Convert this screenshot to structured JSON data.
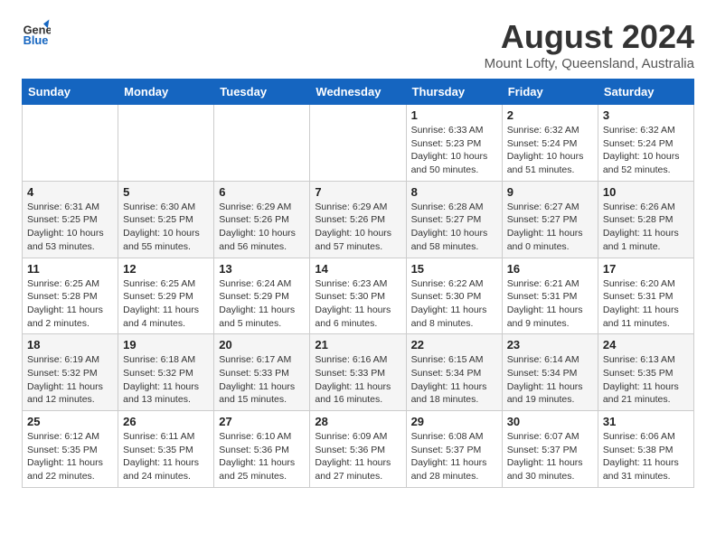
{
  "logo": {
    "line1": "General",
    "line2": "Blue"
  },
  "title": "August 2024",
  "location": "Mount Lofty, Queensland, Australia",
  "days_of_week": [
    "Sunday",
    "Monday",
    "Tuesday",
    "Wednesday",
    "Thursday",
    "Friday",
    "Saturday"
  ],
  "weeks": [
    [
      {
        "date": "",
        "info": ""
      },
      {
        "date": "",
        "info": ""
      },
      {
        "date": "",
        "info": ""
      },
      {
        "date": "",
        "info": ""
      },
      {
        "date": "1",
        "info": "Sunrise: 6:33 AM\nSunset: 5:23 PM\nDaylight: 10 hours\nand 50 minutes."
      },
      {
        "date": "2",
        "info": "Sunrise: 6:32 AM\nSunset: 5:24 PM\nDaylight: 10 hours\nand 51 minutes."
      },
      {
        "date": "3",
        "info": "Sunrise: 6:32 AM\nSunset: 5:24 PM\nDaylight: 10 hours\nand 52 minutes."
      }
    ],
    [
      {
        "date": "4",
        "info": "Sunrise: 6:31 AM\nSunset: 5:25 PM\nDaylight: 10 hours\nand 53 minutes."
      },
      {
        "date": "5",
        "info": "Sunrise: 6:30 AM\nSunset: 5:25 PM\nDaylight: 10 hours\nand 55 minutes."
      },
      {
        "date": "6",
        "info": "Sunrise: 6:29 AM\nSunset: 5:26 PM\nDaylight: 10 hours\nand 56 minutes."
      },
      {
        "date": "7",
        "info": "Sunrise: 6:29 AM\nSunset: 5:26 PM\nDaylight: 10 hours\nand 57 minutes."
      },
      {
        "date": "8",
        "info": "Sunrise: 6:28 AM\nSunset: 5:27 PM\nDaylight: 10 hours\nand 58 minutes."
      },
      {
        "date": "9",
        "info": "Sunrise: 6:27 AM\nSunset: 5:27 PM\nDaylight: 11 hours\nand 0 minutes."
      },
      {
        "date": "10",
        "info": "Sunrise: 6:26 AM\nSunset: 5:28 PM\nDaylight: 11 hours\nand 1 minute."
      }
    ],
    [
      {
        "date": "11",
        "info": "Sunrise: 6:25 AM\nSunset: 5:28 PM\nDaylight: 11 hours\nand 2 minutes."
      },
      {
        "date": "12",
        "info": "Sunrise: 6:25 AM\nSunset: 5:29 PM\nDaylight: 11 hours\nand 4 minutes."
      },
      {
        "date": "13",
        "info": "Sunrise: 6:24 AM\nSunset: 5:29 PM\nDaylight: 11 hours\nand 5 minutes."
      },
      {
        "date": "14",
        "info": "Sunrise: 6:23 AM\nSunset: 5:30 PM\nDaylight: 11 hours\nand 6 minutes."
      },
      {
        "date": "15",
        "info": "Sunrise: 6:22 AM\nSunset: 5:30 PM\nDaylight: 11 hours\nand 8 minutes."
      },
      {
        "date": "16",
        "info": "Sunrise: 6:21 AM\nSunset: 5:31 PM\nDaylight: 11 hours\nand 9 minutes."
      },
      {
        "date": "17",
        "info": "Sunrise: 6:20 AM\nSunset: 5:31 PM\nDaylight: 11 hours\nand 11 minutes."
      }
    ],
    [
      {
        "date": "18",
        "info": "Sunrise: 6:19 AM\nSunset: 5:32 PM\nDaylight: 11 hours\nand 12 minutes."
      },
      {
        "date": "19",
        "info": "Sunrise: 6:18 AM\nSunset: 5:32 PM\nDaylight: 11 hours\nand 13 minutes."
      },
      {
        "date": "20",
        "info": "Sunrise: 6:17 AM\nSunset: 5:33 PM\nDaylight: 11 hours\nand 15 minutes."
      },
      {
        "date": "21",
        "info": "Sunrise: 6:16 AM\nSunset: 5:33 PM\nDaylight: 11 hours\nand 16 minutes."
      },
      {
        "date": "22",
        "info": "Sunrise: 6:15 AM\nSunset: 5:34 PM\nDaylight: 11 hours\nand 18 minutes."
      },
      {
        "date": "23",
        "info": "Sunrise: 6:14 AM\nSunset: 5:34 PM\nDaylight: 11 hours\nand 19 minutes."
      },
      {
        "date": "24",
        "info": "Sunrise: 6:13 AM\nSunset: 5:35 PM\nDaylight: 11 hours\nand 21 minutes."
      }
    ],
    [
      {
        "date": "25",
        "info": "Sunrise: 6:12 AM\nSunset: 5:35 PM\nDaylight: 11 hours\nand 22 minutes."
      },
      {
        "date": "26",
        "info": "Sunrise: 6:11 AM\nSunset: 5:35 PM\nDaylight: 11 hours\nand 24 minutes."
      },
      {
        "date": "27",
        "info": "Sunrise: 6:10 AM\nSunset: 5:36 PM\nDaylight: 11 hours\nand 25 minutes."
      },
      {
        "date": "28",
        "info": "Sunrise: 6:09 AM\nSunset: 5:36 PM\nDaylight: 11 hours\nand 27 minutes."
      },
      {
        "date": "29",
        "info": "Sunrise: 6:08 AM\nSunset: 5:37 PM\nDaylight: 11 hours\nand 28 minutes."
      },
      {
        "date": "30",
        "info": "Sunrise: 6:07 AM\nSunset: 5:37 PM\nDaylight: 11 hours\nand 30 minutes."
      },
      {
        "date": "31",
        "info": "Sunrise: 6:06 AM\nSunset: 5:38 PM\nDaylight: 11 hours\nand 31 minutes."
      }
    ]
  ]
}
